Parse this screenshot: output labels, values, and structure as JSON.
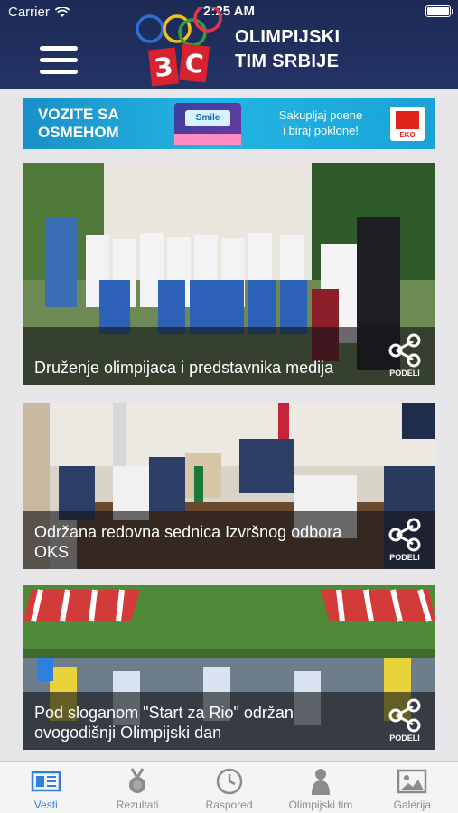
{
  "status_bar": {
    "carrier": "Carrier",
    "time": "2:25 AM"
  },
  "header": {
    "brand_line1": "OLIMPIJSKI",
    "brand_line2": "TIM SRBIJE",
    "logo_letters": "ЗС"
  },
  "ad": {
    "left_line1": "VOZITE SA",
    "left_line2": "OSMEHOM",
    "card_text": "Smile",
    "right_line1": "Sakupljaj poene",
    "right_line2": "i biraj poklone!",
    "brand": "EKO"
  },
  "news": [
    {
      "title": "Druženje olimpijaca i predstavnika medija",
      "share_label": "PODELI"
    },
    {
      "title": "Održana redovna sednica Izvršnog odbora OKS",
      "share_label": "PODELI"
    },
    {
      "title": "Pod sloganom \"Start za Rio\" održan ovogodišnji Olimpijski dan",
      "share_label": "PODELI"
    }
  ],
  "tabs": [
    {
      "label": "Vesti",
      "icon": "news-icon",
      "active": true
    },
    {
      "label": "Rezultati",
      "icon": "medal-icon",
      "active": false
    },
    {
      "label": "Raspored",
      "icon": "clock-icon",
      "active": false
    },
    {
      "label": "Olimpijski tim",
      "icon": "person-icon",
      "active": false
    },
    {
      "label": "Galerija",
      "icon": "gallery-icon",
      "active": false
    }
  ],
  "colors": {
    "header": "#1d2a55",
    "accent": "#2f7fe0",
    "tab_inactive": "#8b8b8f"
  }
}
